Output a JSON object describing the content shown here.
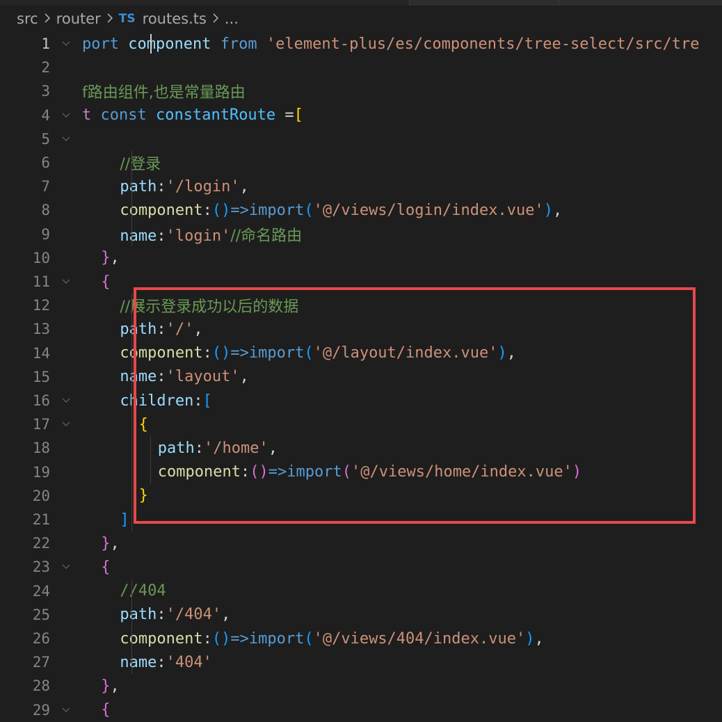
{
  "breadcrumb": {
    "items": [
      "src",
      "router"
    ],
    "file_badge": "TS",
    "file_name": "routes.ts",
    "ellipsis": "..."
  },
  "editor": {
    "active_line": 1,
    "lines": [
      {
        "n": "1",
        "indent": 0,
        "tokens": [
          {
            "t": "port ",
            "c": "tok-kw"
          },
          {
            "t": "component ",
            "c": "tok-prop"
          },
          {
            "t": "from ",
            "c": "tok-kw"
          },
          {
            "t": "'element-plus/es/components/tree-select/src/tre",
            "c": "tok-str"
          }
        ]
      },
      {
        "n": "2",
        "indent": 0,
        "tokens": []
      },
      {
        "n": "3",
        "indent": 0,
        "tokens": [
          {
            "t": "f路由组件,也是常量路由",
            "c": "tok-com comment-cjk"
          }
        ]
      },
      {
        "n": "4",
        "indent": 0,
        "tokens": [
          {
            "t": "t ",
            "c": "tok-ctl"
          },
          {
            "t": "const ",
            "c": "tok-kw"
          },
          {
            "t": "constantRoute",
            "c": "tok-var"
          },
          {
            "t": " =",
            "c": "tok-pun"
          },
          {
            "t": "[",
            "c": "b-gold"
          }
        ]
      },
      {
        "n": "5",
        "indent": 0,
        "tokens": []
      },
      {
        "n": "6",
        "indent": 4,
        "tokens": [
          {
            "t": "//登录",
            "c": "tok-com comment-cjk"
          }
        ]
      },
      {
        "n": "7",
        "indent": 4,
        "tokens": [
          {
            "t": "path",
            "c": "tok-prop"
          },
          {
            "t": ":",
            "c": "tok-pun"
          },
          {
            "t": "'/login'",
            "c": "tok-str"
          },
          {
            "t": ",",
            "c": "tok-pun"
          }
        ]
      },
      {
        "n": "8",
        "indent": 4,
        "tokens": [
          {
            "t": "component",
            "c": "tok-fn"
          },
          {
            "t": ":",
            "c": "tok-pun"
          },
          {
            "t": "()",
            "c": "b-blue"
          },
          {
            "t": "=>",
            "c": "tok-kw"
          },
          {
            "t": "import",
            "c": "tok-kw"
          },
          {
            "t": "(",
            "c": "b-blue"
          },
          {
            "t": "'@/views/login/index.vue'",
            "c": "tok-str"
          },
          {
            "t": ")",
            "c": "b-blue"
          },
          {
            "t": ",",
            "c": "tok-pun"
          }
        ]
      },
      {
        "n": "9",
        "indent": 4,
        "tokens": [
          {
            "t": "name",
            "c": "tok-prop"
          },
          {
            "t": ":",
            "c": "tok-pun"
          },
          {
            "t": "'login'",
            "c": "tok-str"
          },
          {
            "t": "//命名路由",
            "c": "tok-com comment-cjk"
          }
        ]
      },
      {
        "n": "10",
        "indent": 2,
        "tokens": [
          {
            "t": "}",
            "c": "b-purple"
          },
          {
            "t": ",",
            "c": "tok-pun"
          }
        ]
      },
      {
        "n": "11",
        "indent": 2,
        "tokens": [
          {
            "t": "{",
            "c": "b-purple"
          }
        ]
      },
      {
        "n": "12",
        "indent": 4,
        "tokens": [
          {
            "t": "//展示登录成功以后的数据",
            "c": "tok-com comment-cjk"
          }
        ]
      },
      {
        "n": "13",
        "indent": 4,
        "tokens": [
          {
            "t": "path",
            "c": "tok-prop"
          },
          {
            "t": ":",
            "c": "tok-pun"
          },
          {
            "t": "'/'",
            "c": "tok-str"
          },
          {
            "t": ",",
            "c": "tok-pun"
          }
        ]
      },
      {
        "n": "14",
        "indent": 4,
        "tokens": [
          {
            "t": "component",
            "c": "tok-fn"
          },
          {
            "t": ":",
            "c": "tok-pun"
          },
          {
            "t": "()",
            "c": "b-blue"
          },
          {
            "t": "=>",
            "c": "tok-kw"
          },
          {
            "t": "import",
            "c": "tok-kw"
          },
          {
            "t": "(",
            "c": "b-blue"
          },
          {
            "t": "'@/layout/index.vue'",
            "c": "tok-str"
          },
          {
            "t": ")",
            "c": "b-blue"
          },
          {
            "t": ",",
            "c": "tok-pun"
          }
        ]
      },
      {
        "n": "15",
        "indent": 4,
        "tokens": [
          {
            "t": "name",
            "c": "tok-prop"
          },
          {
            "t": ":",
            "c": "tok-pun"
          },
          {
            "t": "'layout'",
            "c": "tok-str"
          },
          {
            "t": ",",
            "c": "tok-pun"
          }
        ]
      },
      {
        "n": "16",
        "indent": 4,
        "tokens": [
          {
            "t": "children",
            "c": "tok-prop"
          },
          {
            "t": ":",
            "c": "tok-pun"
          },
          {
            "t": "[",
            "c": "b-blue"
          }
        ]
      },
      {
        "n": "17",
        "indent": 6,
        "tokens": [
          {
            "t": "{",
            "c": "b-gold"
          }
        ]
      },
      {
        "n": "18",
        "indent": 8,
        "tokens": [
          {
            "t": "path",
            "c": "tok-prop"
          },
          {
            "t": ":",
            "c": "tok-pun"
          },
          {
            "t": "'/home'",
            "c": "tok-str"
          },
          {
            "t": ",",
            "c": "tok-pun"
          }
        ]
      },
      {
        "n": "19",
        "indent": 8,
        "tokens": [
          {
            "t": "component",
            "c": "tok-fn"
          },
          {
            "t": ":",
            "c": "tok-pun"
          },
          {
            "t": "()",
            "c": "b-purple"
          },
          {
            "t": "=>",
            "c": "tok-kw"
          },
          {
            "t": "import",
            "c": "tok-kw"
          },
          {
            "t": "(",
            "c": "b-purple"
          },
          {
            "t": "'@/views/home/index.vue'",
            "c": "tok-str"
          },
          {
            "t": ")",
            "c": "b-purple"
          }
        ]
      },
      {
        "n": "20",
        "indent": 6,
        "tokens": [
          {
            "t": "}",
            "c": "b-gold"
          }
        ]
      },
      {
        "n": "21",
        "indent": 4,
        "tokens": [
          {
            "t": "]",
            "c": "b-blue"
          }
        ]
      },
      {
        "n": "22",
        "indent": 2,
        "tokens": [
          {
            "t": "}",
            "c": "b-purple"
          },
          {
            "t": ",",
            "c": "tok-pun"
          }
        ]
      },
      {
        "n": "23",
        "indent": 2,
        "tokens": [
          {
            "t": "{",
            "c": "b-purple"
          }
        ]
      },
      {
        "n": "24",
        "indent": 4,
        "tokens": [
          {
            "t": "//404",
            "c": "tok-com"
          }
        ]
      },
      {
        "n": "25",
        "indent": 4,
        "tokens": [
          {
            "t": "path",
            "c": "tok-prop"
          },
          {
            "t": ":",
            "c": "tok-pun"
          },
          {
            "t": "'/404'",
            "c": "tok-str"
          },
          {
            "t": ",",
            "c": "tok-pun"
          }
        ]
      },
      {
        "n": "26",
        "indent": 4,
        "tokens": [
          {
            "t": "component",
            "c": "tok-fn"
          },
          {
            "t": ":",
            "c": "tok-pun"
          },
          {
            "t": "()",
            "c": "b-blue"
          },
          {
            "t": "=>",
            "c": "tok-kw"
          },
          {
            "t": "import",
            "c": "tok-kw"
          },
          {
            "t": "(",
            "c": "b-blue"
          },
          {
            "t": "'@/views/404/index.vue'",
            "c": "tok-str"
          },
          {
            "t": ")",
            "c": "b-blue"
          },
          {
            "t": ",",
            "c": "tok-pun"
          }
        ]
      },
      {
        "n": "27",
        "indent": 4,
        "tokens": [
          {
            "t": "name",
            "c": "tok-prop"
          },
          {
            "t": ":",
            "c": "tok-pun"
          },
          {
            "t": "'404'",
            "c": "tok-str"
          }
        ]
      },
      {
        "n": "28",
        "indent": 2,
        "tokens": [
          {
            "t": "}",
            "c": "b-purple"
          },
          {
            "t": ",",
            "c": "tok-pun"
          }
        ]
      },
      {
        "n": "29",
        "indent": 2,
        "tokens": [
          {
            "t": "{",
            "c": "b-purple"
          }
        ]
      }
    ],
    "fold_lines": [
      "1",
      "4",
      "5",
      "11",
      "16",
      "17",
      "23",
      "29"
    ]
  },
  "colors": {
    "background": "#1e1e1e",
    "highlight_box": "#e8484a",
    "line_number": "#858585"
  },
  "icons": {
    "breadcrumb_separator": "chevron-right-icon",
    "fold": "chevron-down-icon"
  }
}
